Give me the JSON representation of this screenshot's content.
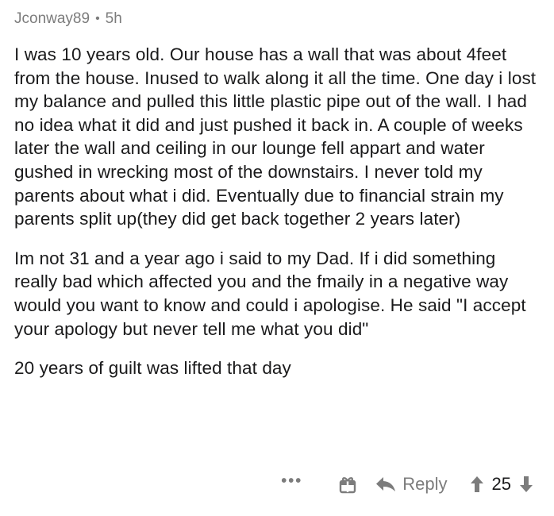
{
  "comment": {
    "author": "Jconway89",
    "separator": "•",
    "age": "5h",
    "paragraphs": [
      "I was 10 years old. Our house has a wall that was about 4feet from the house. Inused to walk along it all the time. One day i lost my balance and pulled this little plastic pipe out of the wall. I had no idea what it did and just pushed it back in. A couple of weeks later the wall and ceiling in our lounge fell appart and water gushed in wrecking most of the downstairs. I never told my parents about what i did. Eventually due to financial strain my parents split up(they did get back together 2 years later)",
      "Im not 31 and a year ago i said to my Dad. If i did something really bad which affected you and the fmaily in a negative way would you want to know and could i apologise. He said \"I accept your apology but never tell me what you did\"",
      "20 years of guilt was lifted that day"
    ]
  },
  "actions": {
    "more_label": "•••",
    "award_icon": "gift-award-icon",
    "reply_icon": "reply-arrow-icon",
    "reply_label": "Reply",
    "upvote_icon": "upvote-arrow-icon",
    "score": "25",
    "downvote_icon": "downvote-arrow-icon"
  },
  "colors": {
    "meta_text": "#7c7c7c",
    "body_text": "#1a1a1b",
    "background": "#ffffff"
  }
}
